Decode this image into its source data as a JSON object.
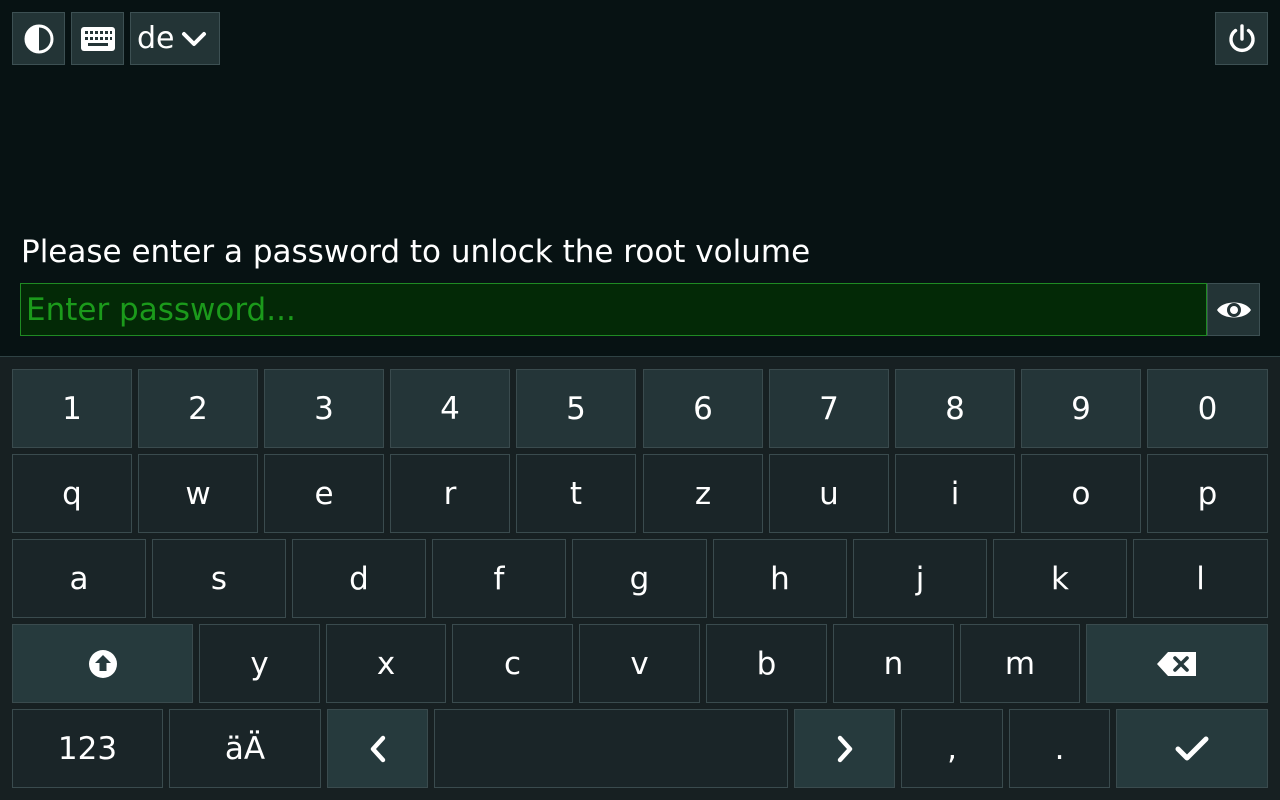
{
  "toolbar": {
    "contrast_icon": "contrast-icon",
    "keyboard_icon": "keyboard-icon",
    "language": "de",
    "language_dropdown_icon": "chevron-down-icon",
    "power_icon": "power-icon"
  },
  "prompt": {
    "text": "Please enter a password to unlock the root volume"
  },
  "password": {
    "value": "",
    "placeholder": "Enter password...",
    "reveal_icon": "eye-icon"
  },
  "keyboard": {
    "row_numbers": [
      "1",
      "2",
      "3",
      "4",
      "5",
      "6",
      "7",
      "8",
      "9",
      "0"
    ],
    "row_top": [
      "q",
      "w",
      "e",
      "r",
      "t",
      "z",
      "u",
      "i",
      "o",
      "p"
    ],
    "row_home": [
      "a",
      "s",
      "d",
      "f",
      "g",
      "h",
      "j",
      "k",
      "l"
    ],
    "row_bottom": [
      "y",
      "x",
      "c",
      "v",
      "b",
      "n",
      "m"
    ],
    "shift_icon": "shift-icon",
    "backspace_icon": "backspace-icon",
    "numbers_label": "123",
    "umlaut_label": "äÄ",
    "left_icon": "chevron-left-icon",
    "right_icon": "chevron-right-icon",
    "comma": ",",
    "period": ".",
    "enter_icon": "check-icon"
  },
  "colors": {
    "background": "#071213",
    "key": "#1a2528",
    "key_light": "#243538",
    "input_bg": "#032906",
    "placeholder": "#1b9a1b"
  }
}
